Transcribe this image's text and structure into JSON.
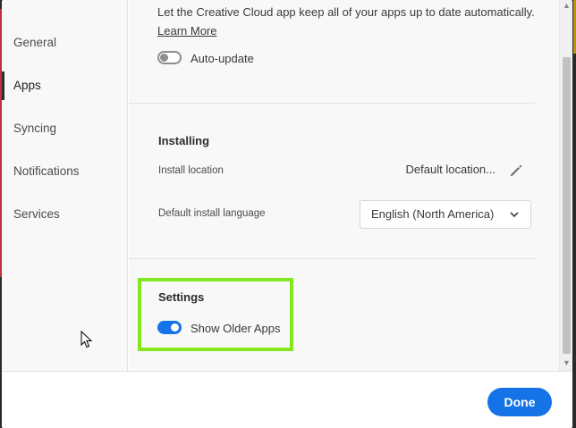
{
  "sidebar": {
    "items": [
      {
        "label": "General",
        "active": false
      },
      {
        "label": "Apps",
        "active": true
      },
      {
        "label": "Syncing",
        "active": false
      },
      {
        "label": "Notifications",
        "active": false
      },
      {
        "label": "Services",
        "active": false
      }
    ]
  },
  "auto_update": {
    "description": "Let the Creative Cloud app keep all of your apps up to date automatically.",
    "learn_more": "Learn More",
    "toggle_label": "Auto-update",
    "enabled": false
  },
  "installing": {
    "title": "Installing",
    "location_label": "Install location",
    "location_value": "Default location...",
    "language_label": "Default install language",
    "language_value": "English (North America)"
  },
  "settings": {
    "title": "Settings",
    "show_older_label": "Show Older Apps",
    "show_older_enabled": true
  },
  "footer": {
    "done_label": "Done"
  },
  "colors": {
    "accent": "#1473e6",
    "highlight": "#84e61d"
  }
}
